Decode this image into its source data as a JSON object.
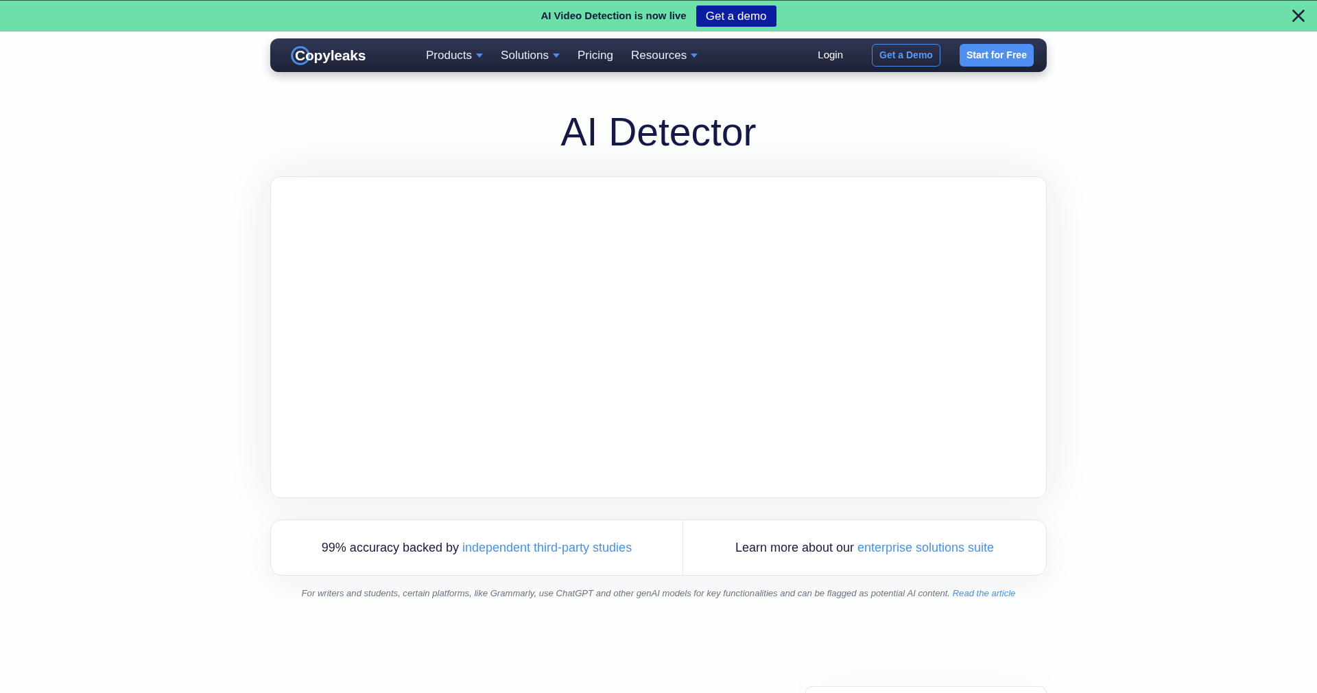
{
  "announcement": {
    "text": "AI Video Detection is now live",
    "button": "Get a demo"
  },
  "navbar": {
    "logo": "Copyleaks",
    "menu": [
      {
        "label": "Products",
        "dropdown": true
      },
      {
        "label": "Solutions",
        "dropdown": true
      },
      {
        "label": "Pricing",
        "dropdown": false
      },
      {
        "label": "Resources",
        "dropdown": true
      }
    ],
    "login": "Login",
    "buttons": [
      {
        "label": "Get a Demo",
        "kind": "outline"
      },
      {
        "label": "Start for Free",
        "kind": "solid"
      }
    ]
  },
  "page_title": "AI Detector",
  "highlights": [
    {
      "text": "99% accuracy backed by",
      "link": "independent third-party studies"
    },
    {
      "text": "Learn more about our",
      "link": "enterprise solutions suite"
    }
  ],
  "footnote": {
    "text": "For writers and students, certain platforms, like Grammarly, use ChatGPT and other genAI models for key functionalities and can be flagged as potential AI content.",
    "link": "Read the article"
  }
}
